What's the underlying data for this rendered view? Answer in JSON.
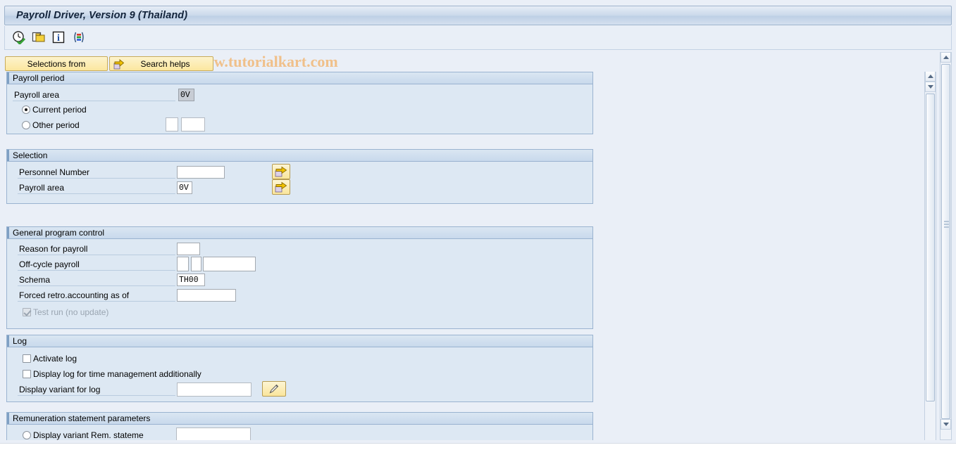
{
  "window": {
    "title": "Payroll Driver, Version 9 (Thailand)"
  },
  "watermark": "© www.tutorialkart.com",
  "toolbar": {
    "icons": [
      {
        "name": "execute-clock-icon",
        "title": "Execute"
      },
      {
        "name": "copy-document-icon",
        "title": "Get Variant"
      },
      {
        "name": "info-icon",
        "title": "Information"
      },
      {
        "name": "color-legend-icon",
        "title": "Legend"
      }
    ]
  },
  "buttons": {
    "selections_from": "Selections from",
    "search_helps": "Search helps"
  },
  "sections": {
    "payroll_period": {
      "title": "Payroll period",
      "payroll_area_label": "Payroll area",
      "payroll_area_value": "0V",
      "current_period_label": "Current period",
      "current_period_selected": true,
      "other_period_label": "Other period",
      "other_period_selected": false,
      "other_period_value_1": "",
      "other_period_value_2": ""
    },
    "selection": {
      "title": "Selection",
      "personnel_number_label": "Personnel Number",
      "personnel_number_value": "",
      "payroll_area_label": "Payroll area",
      "payroll_area_value": "0V",
      "multi_select_icon": "multiple-selection-arrow-icon"
    },
    "general_program_control": {
      "title": "General program control",
      "reason_label": "Reason for payroll",
      "reason_value": "",
      "offcycle_label": "Off-cycle payroll",
      "offcycle_value_1": "",
      "offcycle_value_2": "",
      "offcycle_value_3": "",
      "schema_label": "Schema",
      "schema_value": "TH00",
      "forced_retro_label": "Forced retro.accounting as of",
      "forced_retro_value": "",
      "test_run_label": "Test run (no update)",
      "test_run_checked": true,
      "test_run_disabled": true
    },
    "log": {
      "title": "Log",
      "activate_log_label": "Activate log",
      "activate_log_checked": false,
      "display_log_time_label": "Display log for time management additionally",
      "display_log_time_checked": false,
      "display_variant_label": "Display variant for log",
      "display_variant_value": "",
      "edit_icon": "pencil-edit-icon"
    },
    "remuneration": {
      "title": "Remuneration statement parameters",
      "display_variant_label": "Display variant Rem. stateme",
      "display_variant_selected": false,
      "display_variant_value": ""
    }
  },
  "scrollbars": {
    "inner_up": "scroll-up-arrow",
    "inner_down": "scroll-down-arrow",
    "outer_up": "scroll-up-arrow",
    "outer_down": "scroll-down-arrow"
  }
}
